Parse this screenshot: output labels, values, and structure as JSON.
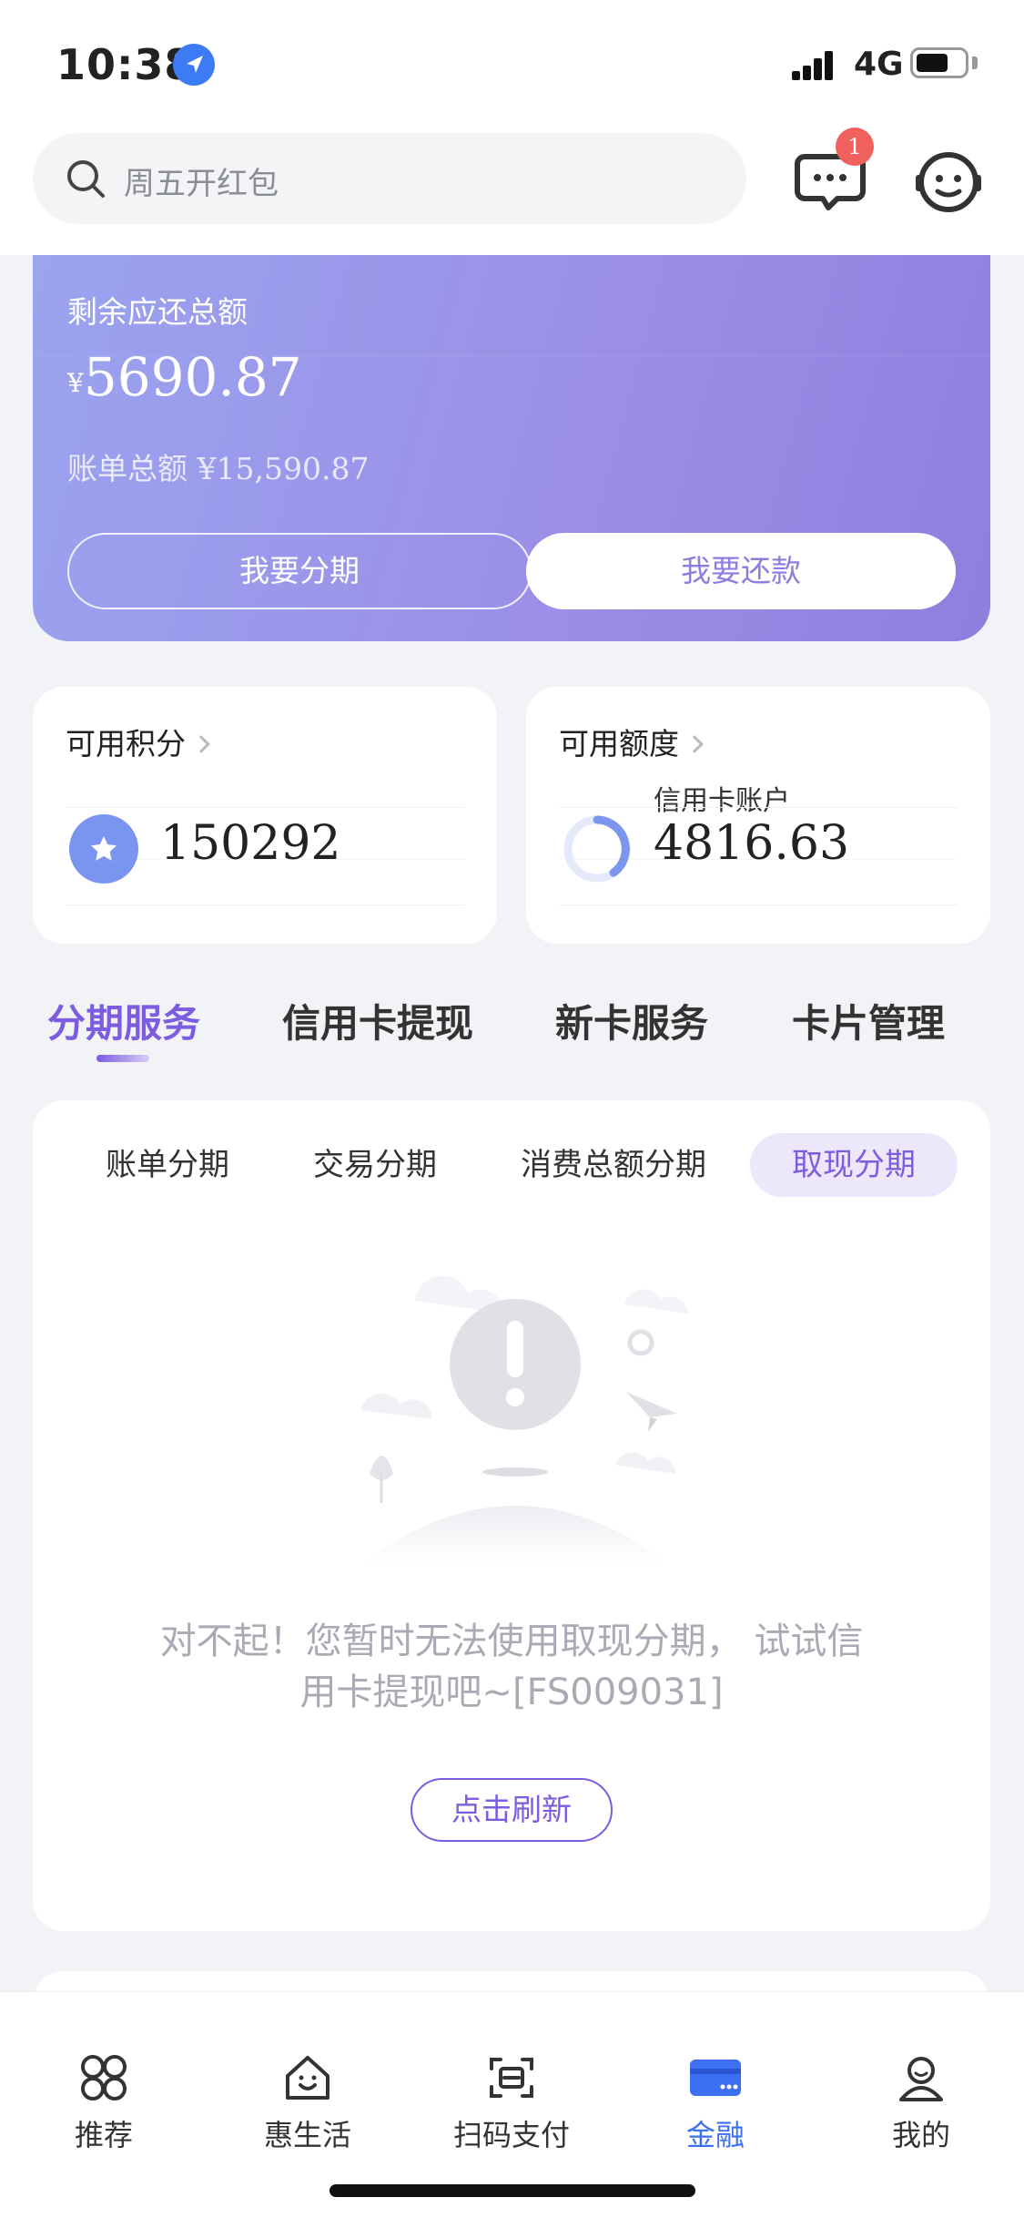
{
  "status_bar": {
    "time": "10:38",
    "network": "4G",
    "battery_level": 0.6
  },
  "search": {
    "placeholder": "周五开红包"
  },
  "header": {
    "message_badge": "1"
  },
  "bill": {
    "title": "剩余应还总额",
    "currency": "¥",
    "amount": "5690.87",
    "total_label": "账单总额",
    "total_value": "¥15,590.87",
    "installment_button": "我要分期",
    "repay_button": "我要还款"
  },
  "points": {
    "title": "可用积分",
    "value": "150292"
  },
  "credit": {
    "title": "可用额度",
    "subtitle": "信用卡账户",
    "value": "4816.63"
  },
  "tabs": [
    "分期服务",
    "信用卡提现",
    "新卡服务",
    "卡片管理"
  ],
  "subtabs": [
    "账单分期",
    "交易分期",
    "消费总额分期",
    "取现分期"
  ],
  "empty_state": {
    "message": "对不起！您暂时无法使用取现分期， 试试信用卡提现吧~[FS009031]",
    "refresh_button": "点击刷新"
  },
  "bottom_nav": [
    "推荐",
    "惠生活",
    "扫码支付",
    "金融",
    "我的"
  ],
  "colors": {
    "accent": "#7c5ce0",
    "nav_active": "#3d6ff2",
    "card_gradient_start": "#9aa4ef",
    "card_gradient_end": "#8f7fde"
  }
}
